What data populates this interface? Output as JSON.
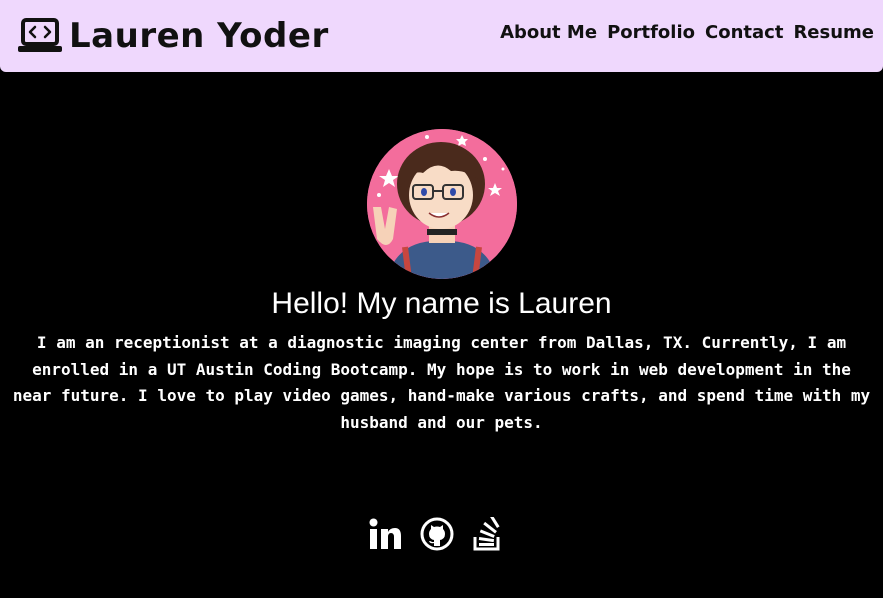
{
  "header": {
    "logo_icon": "laptop-code-icon",
    "brand_name": "Lauren Yoder",
    "background_color": "#efd8fd",
    "nav": [
      {
        "label": "About Me"
      },
      {
        "label": "Portfolio"
      },
      {
        "label": "Contact"
      },
      {
        "label": "Resume"
      }
    ]
  },
  "main": {
    "avatar_icon": "profile-avatar-illustration",
    "greeting": "Hello! My name is Lauren",
    "bio": "I am an receptionist at a diagnostic imaging center from Dallas, TX. Currently, I am enrolled in a UT Austin Coding Bootcamp. My hope is to work in web development in the near future. I love to play video games, hand-make various crafts, and spend time with my husband and our pets."
  },
  "footer": {
    "social": [
      {
        "icon": "linkedin-icon"
      },
      {
        "icon": "github-icon"
      },
      {
        "icon": "stack-overflow-icon"
      }
    ]
  }
}
